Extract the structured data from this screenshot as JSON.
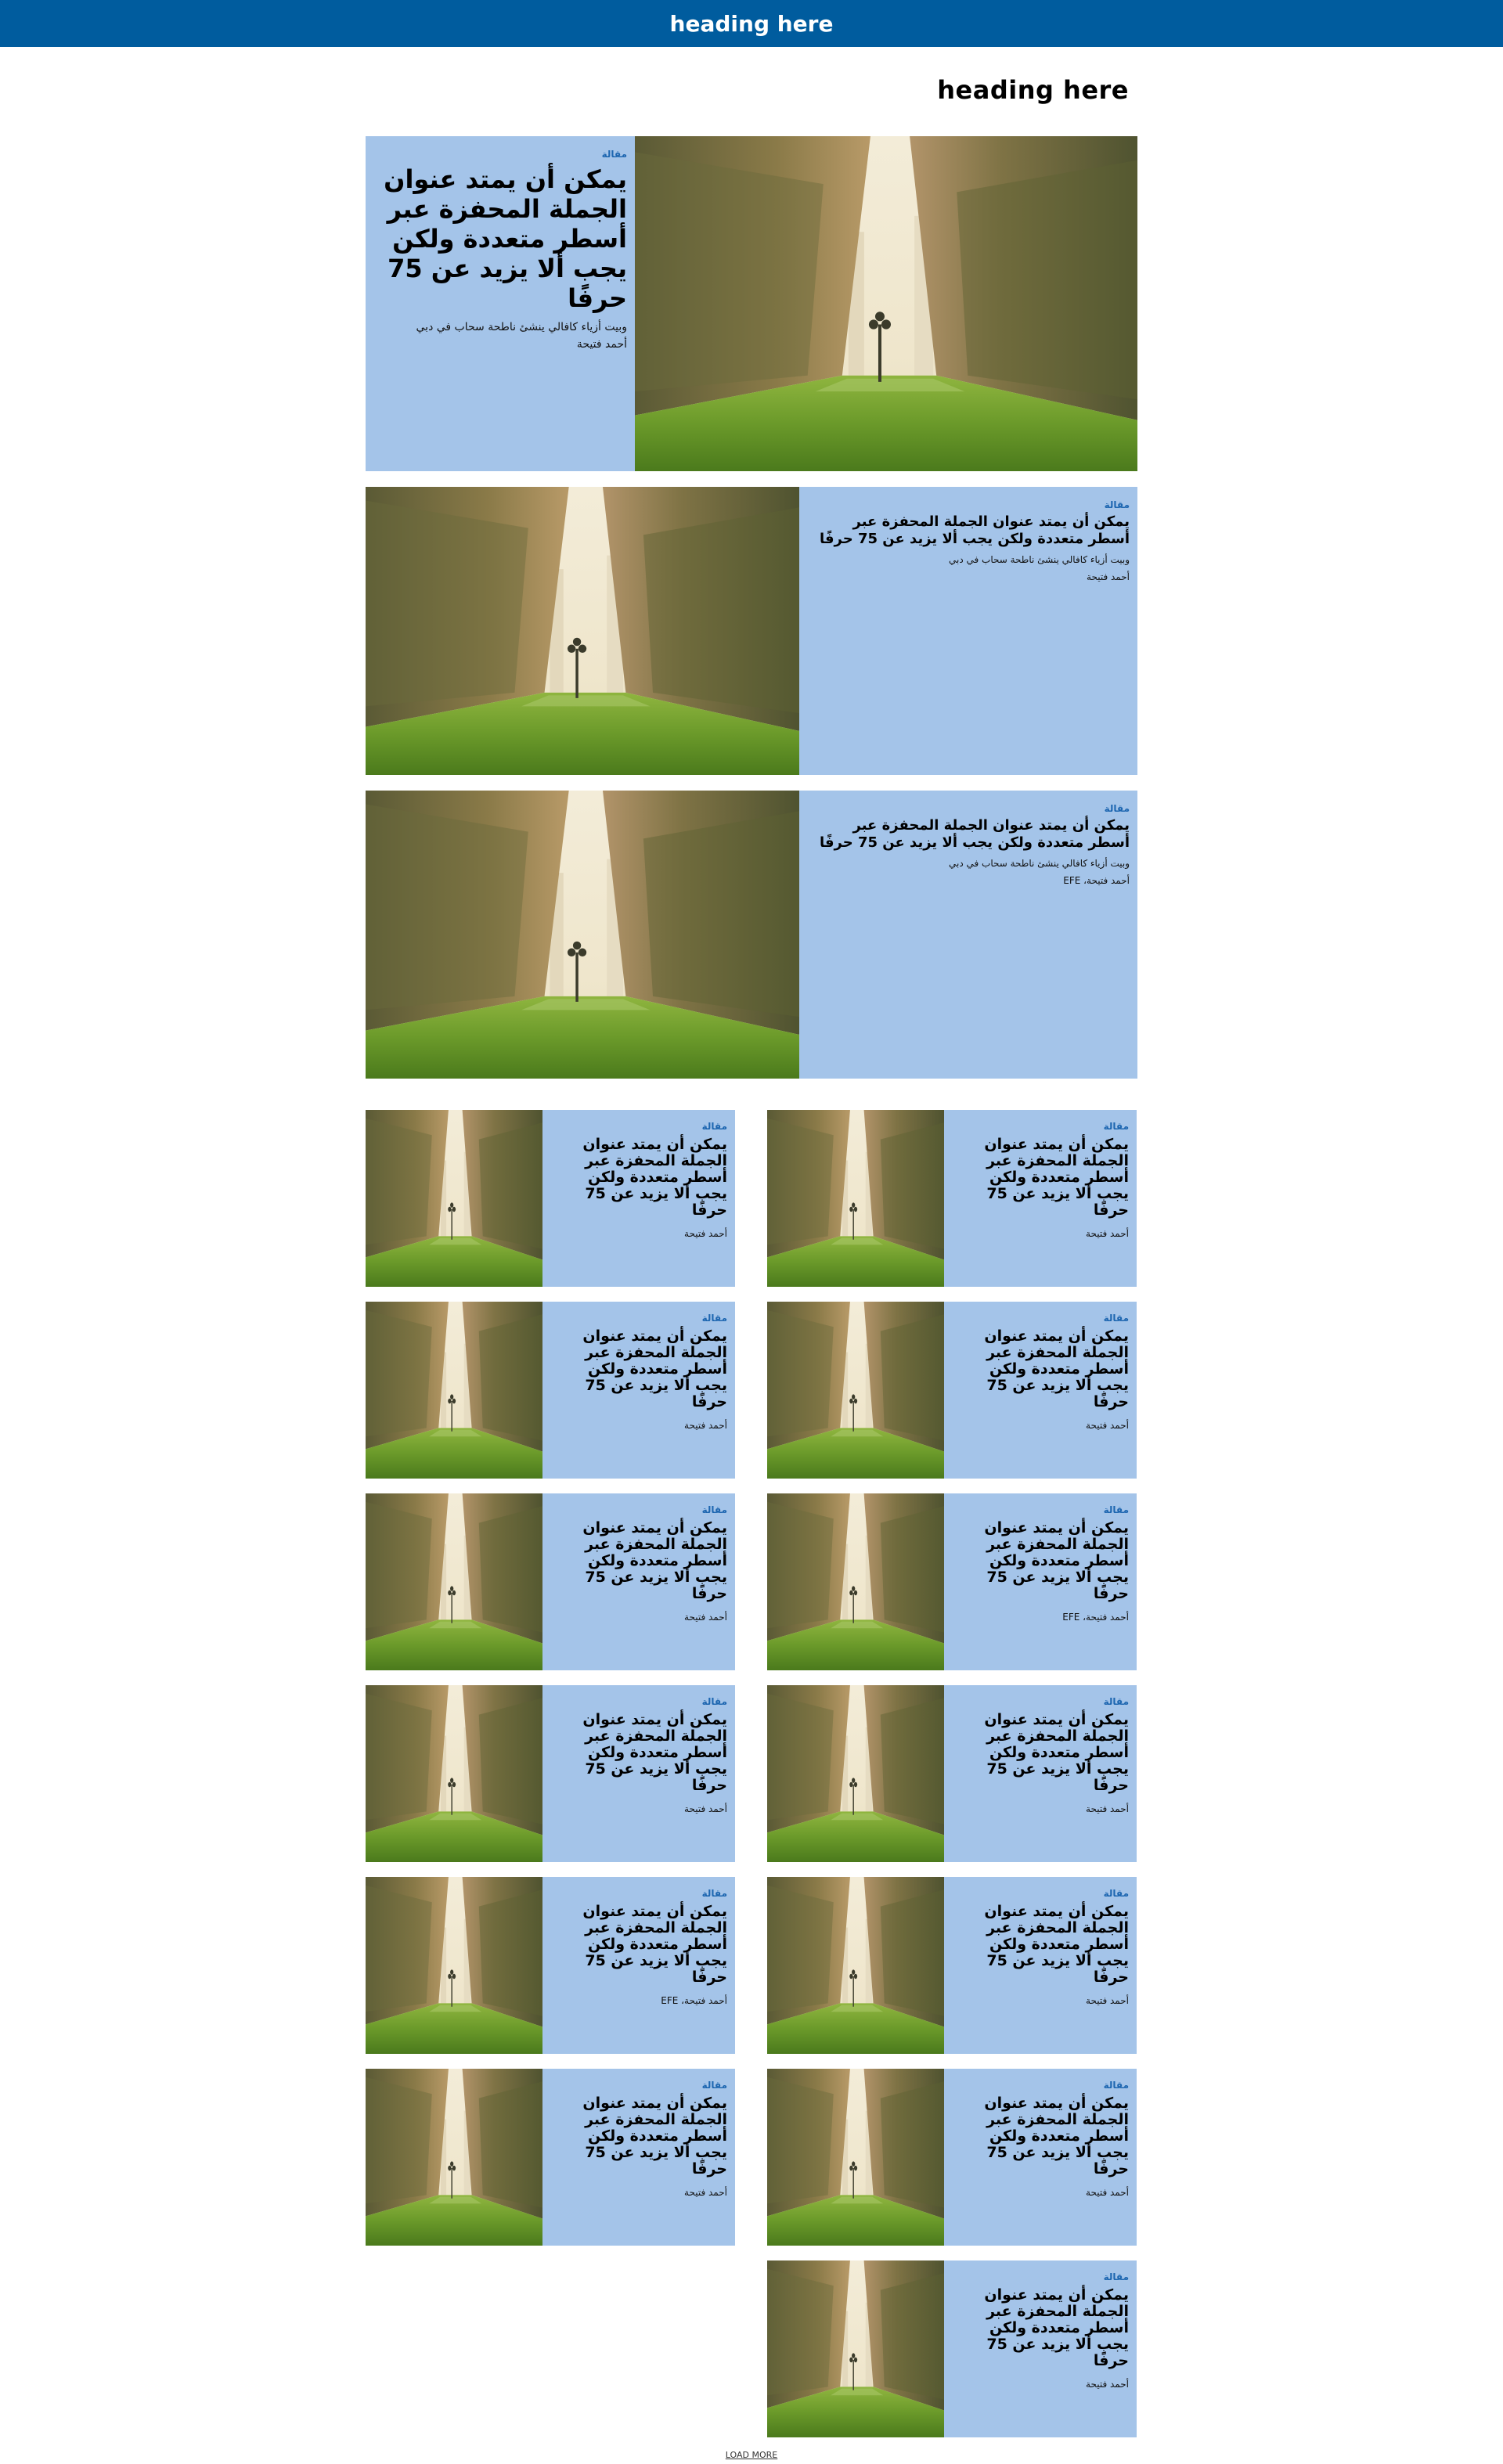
{
  "header": {
    "title": "heading here"
  },
  "page_heading": "heading here",
  "hero": {
    "tag": "مقالة",
    "title": "يمكن أن يمتد عنوان الجملة المحفزة عبر أسطر متعددة ولكن يجب ألا يزيد عن 75 حرفًا",
    "subtitle": "وبيت أزياء كافالي ينشئ ناطحة سحاب في دبي",
    "author": "أحمد فتيحة"
  },
  "medium_cards": [
    {
      "tag": "مقالة",
      "title": "يمكن أن يمتد عنوان الجملة المحفزة عبر أسطر متعددة ولكن يجب ألا يزيد عن 75 حرفًا",
      "subtitle": "وبيت أزياء كافالي ينشئ ناطحة سحاب في دبي",
      "author": "أحمد فتيحة"
    },
    {
      "tag": "مقالة",
      "title": "يمكن أن يمتد عنوان الجملة المحفزة عبر أسطر متعددة ولكن يجب ألا يزيد عن 75 حرفًا",
      "subtitle": "وبيت أزياء كافالي ينشئ ناطحة سحاب في دبي",
      "author": "أحمد فتيحة، EFE"
    }
  ],
  "grid_cards": [
    {
      "tag": "مقالة",
      "title": "يمكن أن يمتد عنوان الجملة المحفزة عبر أسطر متعددة ولكن يجب ألا يزيد عن 75 حرفًا",
      "author": "أحمد فتيحة"
    },
    {
      "tag": "مقالة",
      "title": "يمكن أن يمتد عنوان الجملة المحفزة عبر أسطر متعددة ولكن يجب ألا يزيد عن 75 حرفًا",
      "author": "أحمد فتيحة"
    },
    {
      "tag": "مقالة",
      "title": "يمكن أن يمتد عنوان الجملة المحفزة عبر أسطر متعددة ولكن يجب ألا يزيد عن 75 حرفًا",
      "author": "أحمد فتيحة"
    },
    {
      "tag": "مقالة",
      "title": "يمكن أن يمتد عنوان الجملة المحفزة عبر أسطر متعددة ولكن يجب ألا يزيد عن 75 حرفًا",
      "author": "أحمد فتيحة"
    },
    {
      "tag": "مقالة",
      "title": "يمكن أن يمتد عنوان الجملة المحفزة عبر أسطر متعددة ولكن يجب ألا يزيد عن 75 حرفًا",
      "author": "أحمد فتيحة، EFE"
    },
    {
      "tag": "مقالة",
      "title": "يمكن أن يمتد عنوان الجملة المحفزة عبر أسطر متعددة ولكن يجب ألا يزيد عن 75 حرفًا",
      "author": "أحمد فتيحة"
    },
    {
      "tag": "مقالة",
      "title": "يمكن أن يمتد عنوان الجملة المحفزة عبر أسطر متعددة ولكن يجب ألا يزيد عن 75 حرفًا",
      "author": "أحمد فتيحة"
    },
    {
      "tag": "مقالة",
      "title": "يمكن أن يمتد عنوان الجملة المحفزة عبر أسطر متعددة ولكن يجب ألا يزيد عن 75 حرفًا",
      "author": "أحمد فتيحة"
    },
    {
      "tag": "مقالة",
      "title": "يمكن أن يمتد عنوان الجملة المحفزة عبر أسطر متعددة ولكن يجب ألا يزيد عن 75 حرفًا",
      "author": "أحمد فتيحة"
    },
    {
      "tag": "مقالة",
      "title": "يمكن أن يمتد عنوان الجملة المحفزة عبر أسطر متعددة ولكن يجب ألا يزيد عن 75 حرفًا",
      "author": "أحمد فتيحة، EFE"
    },
    {
      "tag": "مقالة",
      "title": "يمكن أن يمتد عنوان الجملة المحفزة عبر أسطر متعددة ولكن يجب ألا يزيد عن 75 حرفًا",
      "author": "أحمد فتيحة"
    },
    {
      "tag": "مقالة",
      "title": "يمكن أن يمتد عنوان الجملة المحفزة عبر أسطر متعددة ولكن يجب ألا يزيد عن 75 حرفًا",
      "author": "أحمد فتيحة"
    },
    {
      "tag": "مقالة",
      "title": "يمكن أن يمتد عنوان الجملة المحفزة عبر أسطر متعددة ولكن يجب ألا يزيد عن 75 حرفًا",
      "author": "أحمد فتيحة"
    }
  ],
  "load_more": "LOAD MORE",
  "colors": {
    "header_bg": "#005c9e",
    "card_bg": "#a4c4e9",
    "tag": "#1d66b0"
  }
}
